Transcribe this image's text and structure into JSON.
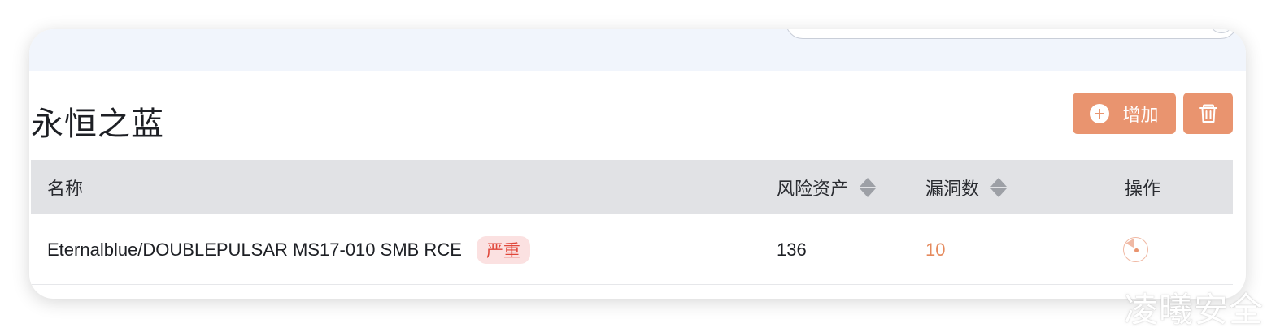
{
  "page": {
    "title": "永恒之蓝"
  },
  "toolbar": {
    "add_label": "增加"
  },
  "table": {
    "columns": [
      "名称",
      "风险资产",
      "漏洞数",
      "操作"
    ],
    "rows": [
      {
        "name": "Eternalblue/DOUBLEPULSAR MS17-010 SMB RCE",
        "severity": "严重",
        "risk_assets": "136",
        "vuln_count": "10"
      }
    ]
  },
  "watermark": "凌曦安全",
  "colors": {
    "accent": "#e9946f",
    "severity_critical": "#e0473a",
    "header_bg": "#e1e2e5",
    "top_band": "#f1f5fc"
  },
  "icons": {
    "add": "plus-circle-icon",
    "delete": "trash-icon",
    "sort": "sort-icon",
    "action": "scan-icon"
  }
}
